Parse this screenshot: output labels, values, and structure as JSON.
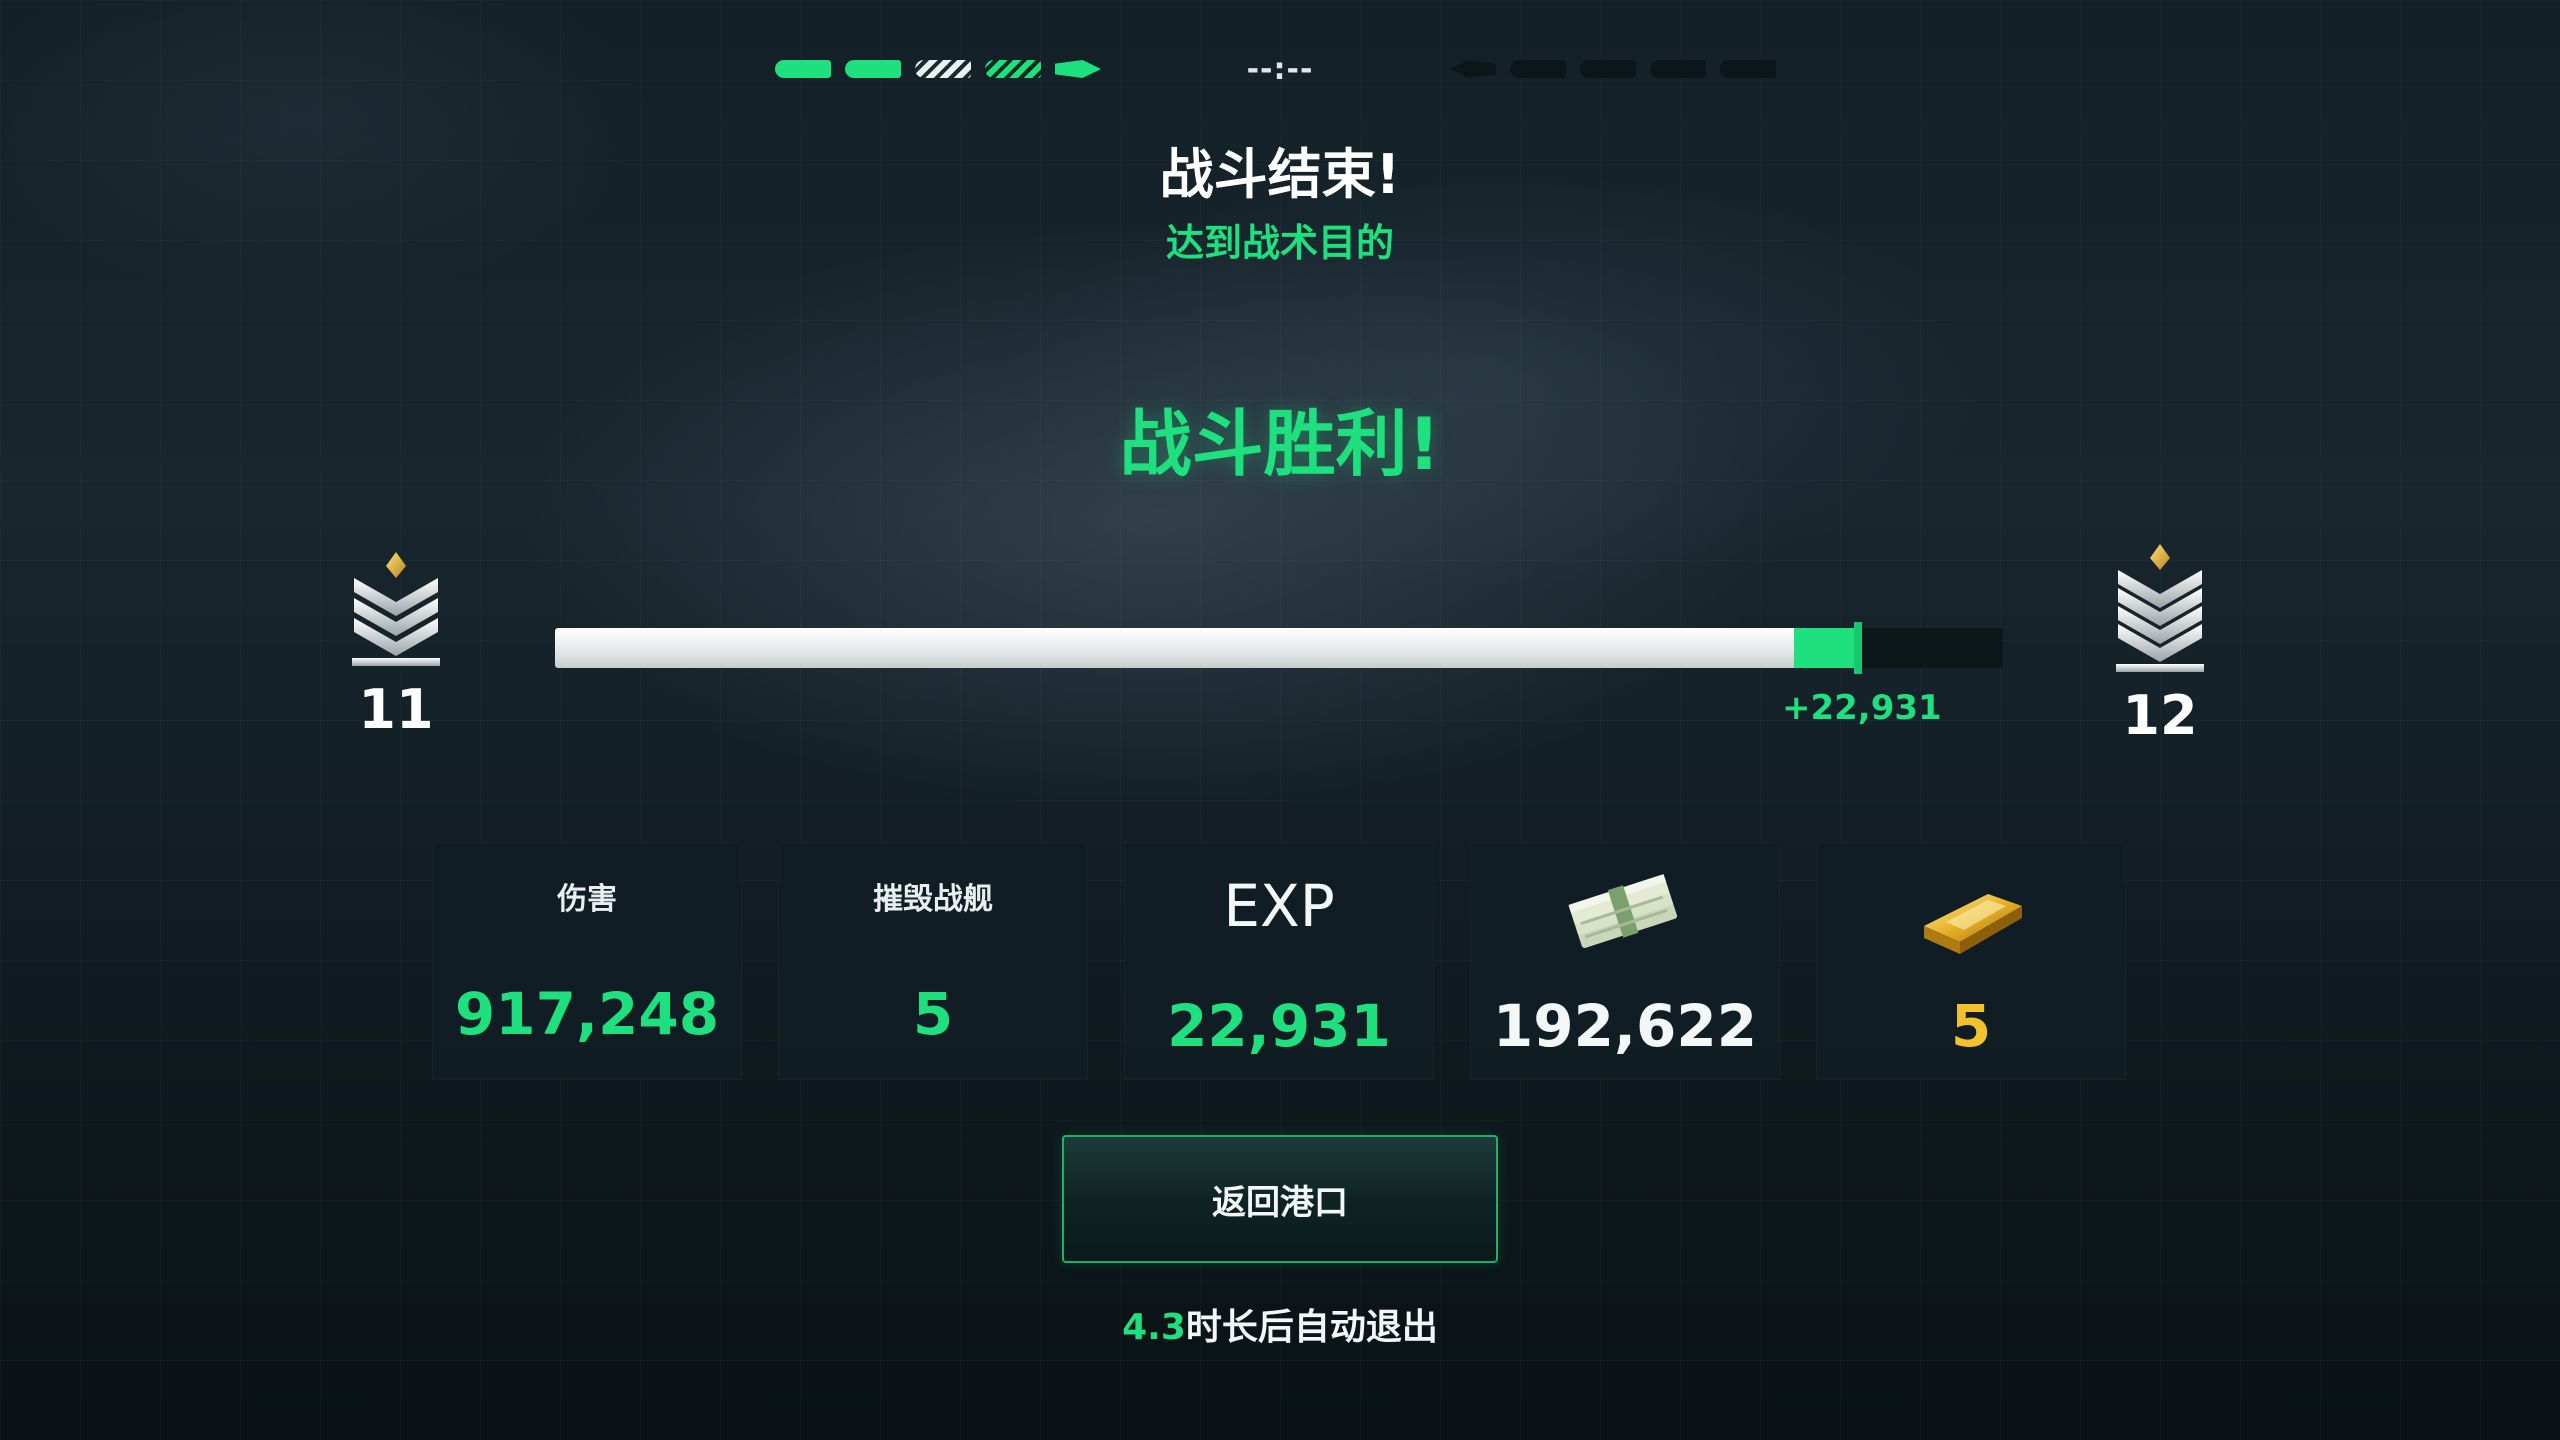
{
  "header": {
    "timer": "--:--",
    "ally_ships": [
      "alive",
      "alive",
      "hit",
      "damaged",
      "alive-small"
    ],
    "enemy_ships": [
      "destroyed-small",
      "destroyed",
      "destroyed",
      "destroyed",
      "destroyed"
    ]
  },
  "result": {
    "battle_over": "战斗结束!",
    "objective": "达到战术目的",
    "victory": "战斗胜利!"
  },
  "rank": {
    "current_level": "11",
    "next_level": "12",
    "rank_icon": "chevron-rank-insignia-icon",
    "progress_before": 0.856,
    "progress_after": 0.9,
    "gain_label": "+22,931"
  },
  "stats": {
    "damage_label": "伤害",
    "damage_value": "917,248",
    "kills_label": "摧毁战舰",
    "kills_value": "5",
    "exp_label": "EXP",
    "exp_value": "22,931",
    "money_icon": "cash-stack-icon",
    "money_value": "192,622",
    "gold_icon": "gold-bar-icon",
    "gold_value": "5"
  },
  "actions": {
    "return_label": "返回港口",
    "auto_exit_seconds": "4.3",
    "auto_exit_text": "时长后自动退出"
  },
  "colors": {
    "accent_green": "#1ee07f",
    "gold": "#f3c22b",
    "background": "#132027"
  }
}
